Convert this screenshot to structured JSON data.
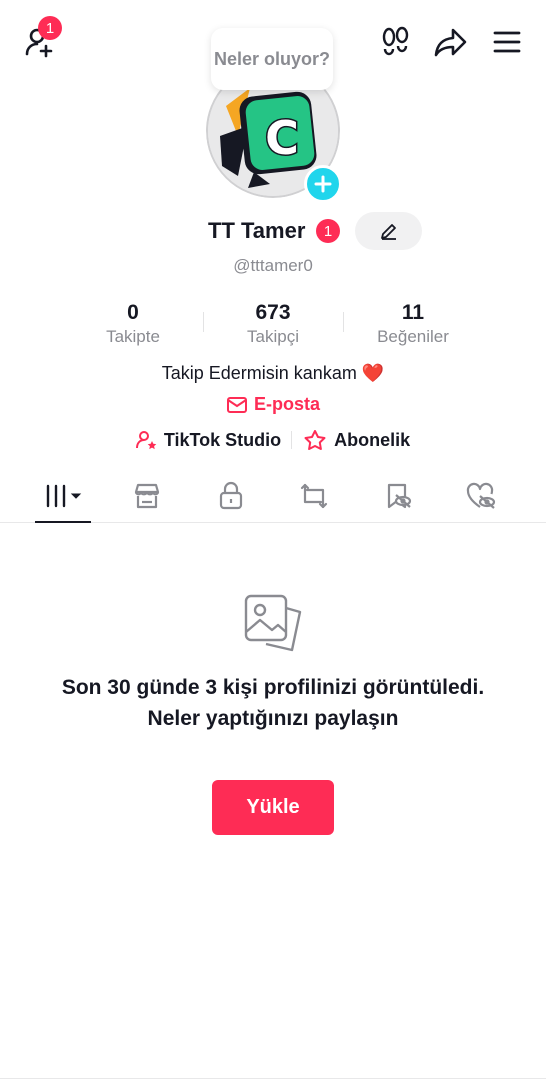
{
  "header": {
    "add_friend_badge": "1",
    "prompt_bubble": "Neler oluyor?"
  },
  "profile": {
    "name": "TT Tamer",
    "name_badge": "1",
    "handle": "@tttamer0",
    "bio": "Takip Edermisin kankam ❤️",
    "email_label": "E-posta"
  },
  "stats": [
    {
      "value": "0",
      "label": "Takipte"
    },
    {
      "value": "673",
      "label": "Takipçi"
    },
    {
      "value": "11",
      "label": "Beğeniler"
    }
  ],
  "links": {
    "studio": "TikTok Studio",
    "subscription": "Abonelik"
  },
  "tabs": [
    {
      "icon": "videos-grid-icon",
      "active": true
    },
    {
      "icon": "shop-icon",
      "active": false
    },
    {
      "icon": "lock-icon",
      "active": false
    },
    {
      "icon": "repost-icon",
      "active": false
    },
    {
      "icon": "bookmark-hidden-icon",
      "active": false
    },
    {
      "icon": "liked-hidden-icon",
      "active": false
    }
  ],
  "empty_state": {
    "message": "Son 30 günde 3 kişi profilinizi görüntüledi. Neler yaptığınızı paylaşın",
    "button": "Yükle"
  },
  "colors": {
    "accent": "#fe2c55",
    "add_avatar": "#20d5ec",
    "secondary_text": "#8a8b91"
  }
}
